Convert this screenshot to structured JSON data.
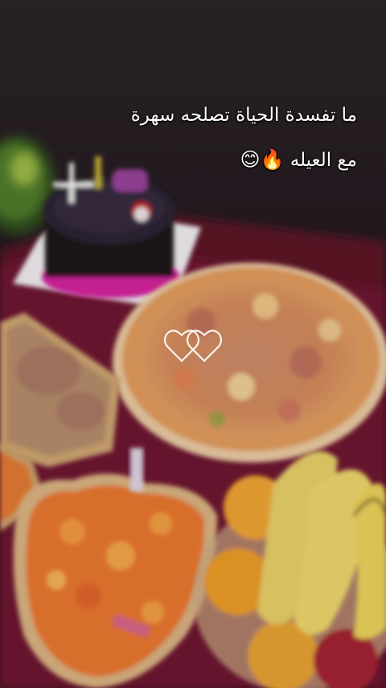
{
  "caption": {
    "line1": "ما تفسدة الحياة تصلحه سهرة",
    "line2": "مع العيله",
    "line2_emojis": "🔥😊"
  },
  "scene_objects": [
    "chocolate-cake",
    "pizza",
    "cheese-puff-snacks",
    "pretzel-snacks",
    "bananas",
    "oranges",
    "salad",
    "hearts-sticker"
  ],
  "colors": {
    "background_dark": "#1c1418",
    "tablecloth": "#6e1830",
    "cake_ribbon": "#d0209a",
    "pizza_crust": "#d9955a",
    "snack_orange": "#e6752e",
    "banana_yellow": "#e8cf5a",
    "orange_fruit": "#eaa230"
  }
}
